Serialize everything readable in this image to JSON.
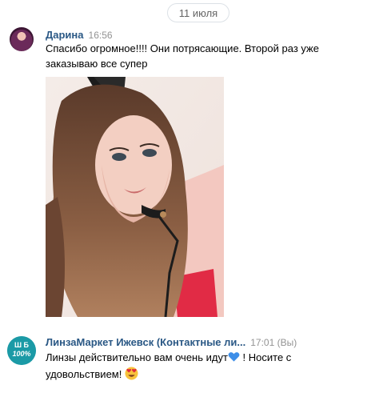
{
  "date_separator": "11 июля",
  "messages": [
    {
      "author": "Дарина",
      "time": "16:56",
      "text_line1": "Спасибо огромное!!!! Они потрясающие. Второй раз уже",
      "text_line2": "заказываю все супер"
    },
    {
      "author": "ЛинзаМаркет Ижевск (Контактные ли...",
      "time": "17:01 (Вы)",
      "text_part1": "Линзы действительно вам очень идут",
      "text_part2": " ! Носите с",
      "text_line2": "удовольствием! "
    }
  ],
  "avatar_logo_text": {
    "letters": "Ш Б",
    "percent": "100%"
  },
  "colors": {
    "author": "#2a5885",
    "time": "#939393",
    "date_border": "#dce1e6",
    "heart": "#3d8ee8",
    "avatar_logo_bg": "#1b9aa6"
  },
  "icons": [
    "blue-heart-emoji-icon",
    "heart-eyes-emoji-icon"
  ]
}
